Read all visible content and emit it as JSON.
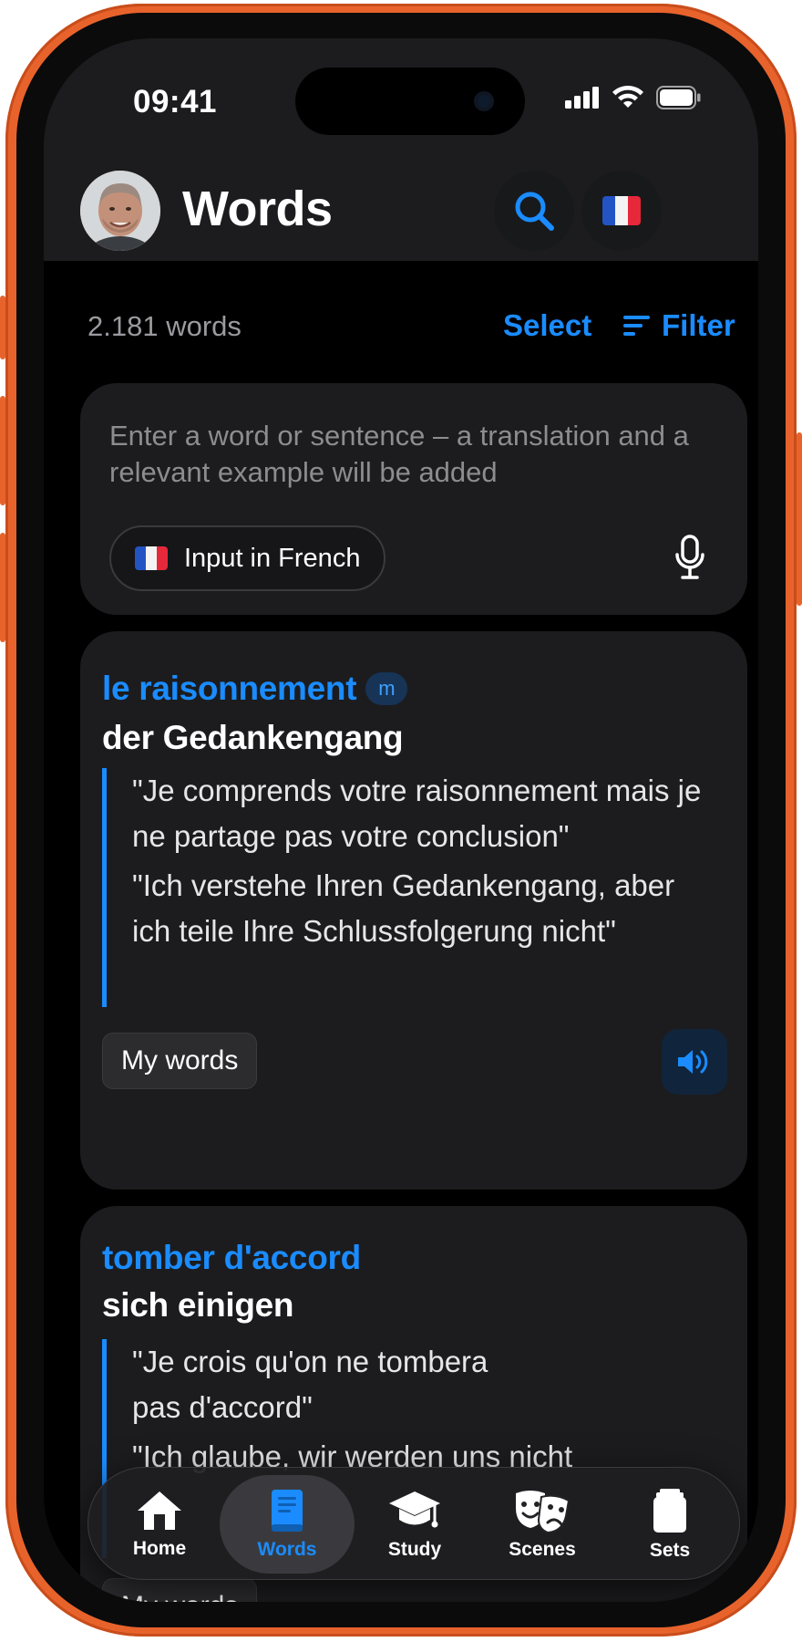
{
  "status": {
    "time": "09:41"
  },
  "header": {
    "title": "Words"
  },
  "toolbar": {
    "word_count": "2.181 words",
    "select_label": "Select",
    "filter_label": "Filter"
  },
  "input": {
    "placeholder": "Enter a word or sentence – a translation and a relevant example will be added",
    "language_chip": "Input in French"
  },
  "words": [
    {
      "term": "le raisonnement",
      "gender": "m",
      "translation": "der Gedankengang",
      "example_fr": "\"Je comprends votre raisonnement mais je ne partage pas votre conclusion\"",
      "example_de": "\"Ich verstehe Ihren Gedankengang, aber ich teile Ihre Schlussfolgerung nicht\"",
      "tag": "My words"
    },
    {
      "term": "tomber d'accord",
      "translation": "sich einigen",
      "example_fr": "\"Je crois qu'on ne tombera pas d'accord\"",
      "example_de": "\"Ich glaube, wir werden uns nicht",
      "tag": "My words"
    }
  ],
  "tabbar": {
    "tabs": [
      {
        "label": "Home",
        "icon": "house-icon"
      },
      {
        "label": "Words",
        "icon": "book-icon",
        "active": true
      },
      {
        "label": "Study",
        "icon": "graduation-cap-icon"
      },
      {
        "label": "Scenes",
        "icon": "theater-masks-icon"
      },
      {
        "label": "Sets",
        "icon": "flashcards-icon"
      }
    ]
  },
  "colors": {
    "accent": "#1a8cff",
    "frame": "#e8632c",
    "card": "#1c1c1e",
    "background": "#000000"
  }
}
